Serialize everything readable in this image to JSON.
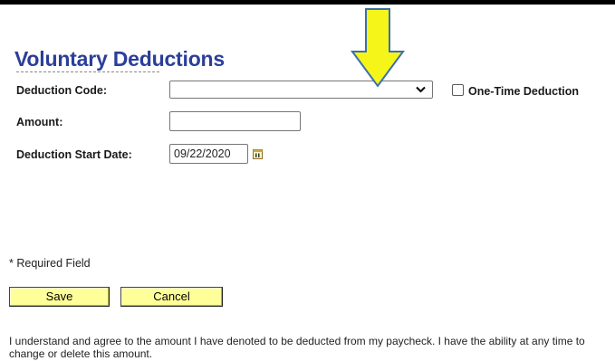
{
  "page": {
    "title": "Voluntary Deductions"
  },
  "form": {
    "deduction_code_label": "Deduction Code:",
    "deduction_code_value": "",
    "one_time_label": "One-Time Deduction",
    "one_time_checked": false,
    "amount_label": "Amount:",
    "amount_value": "",
    "start_date_label": "Deduction Start Date:",
    "start_date_value": "09/22/2020",
    "required_note": "* Required Field"
  },
  "actions": {
    "save_label": "Save",
    "cancel_label": "Cancel"
  },
  "agreement_text": "I understand and agree to the amount I have denoted to be deducted from my paycheck. I have the ability at any time to change or delete this amount.",
  "icons": {
    "select_chevron": "chevron-down-icon",
    "calendar": "calendar-icon",
    "callout": "arrow-down-icon"
  },
  "colors": {
    "title": "#2b3e9a",
    "button_bg": "#ffff99",
    "arrow_fill": "#f5f51a",
    "arrow_stroke": "#3a6fb0"
  }
}
